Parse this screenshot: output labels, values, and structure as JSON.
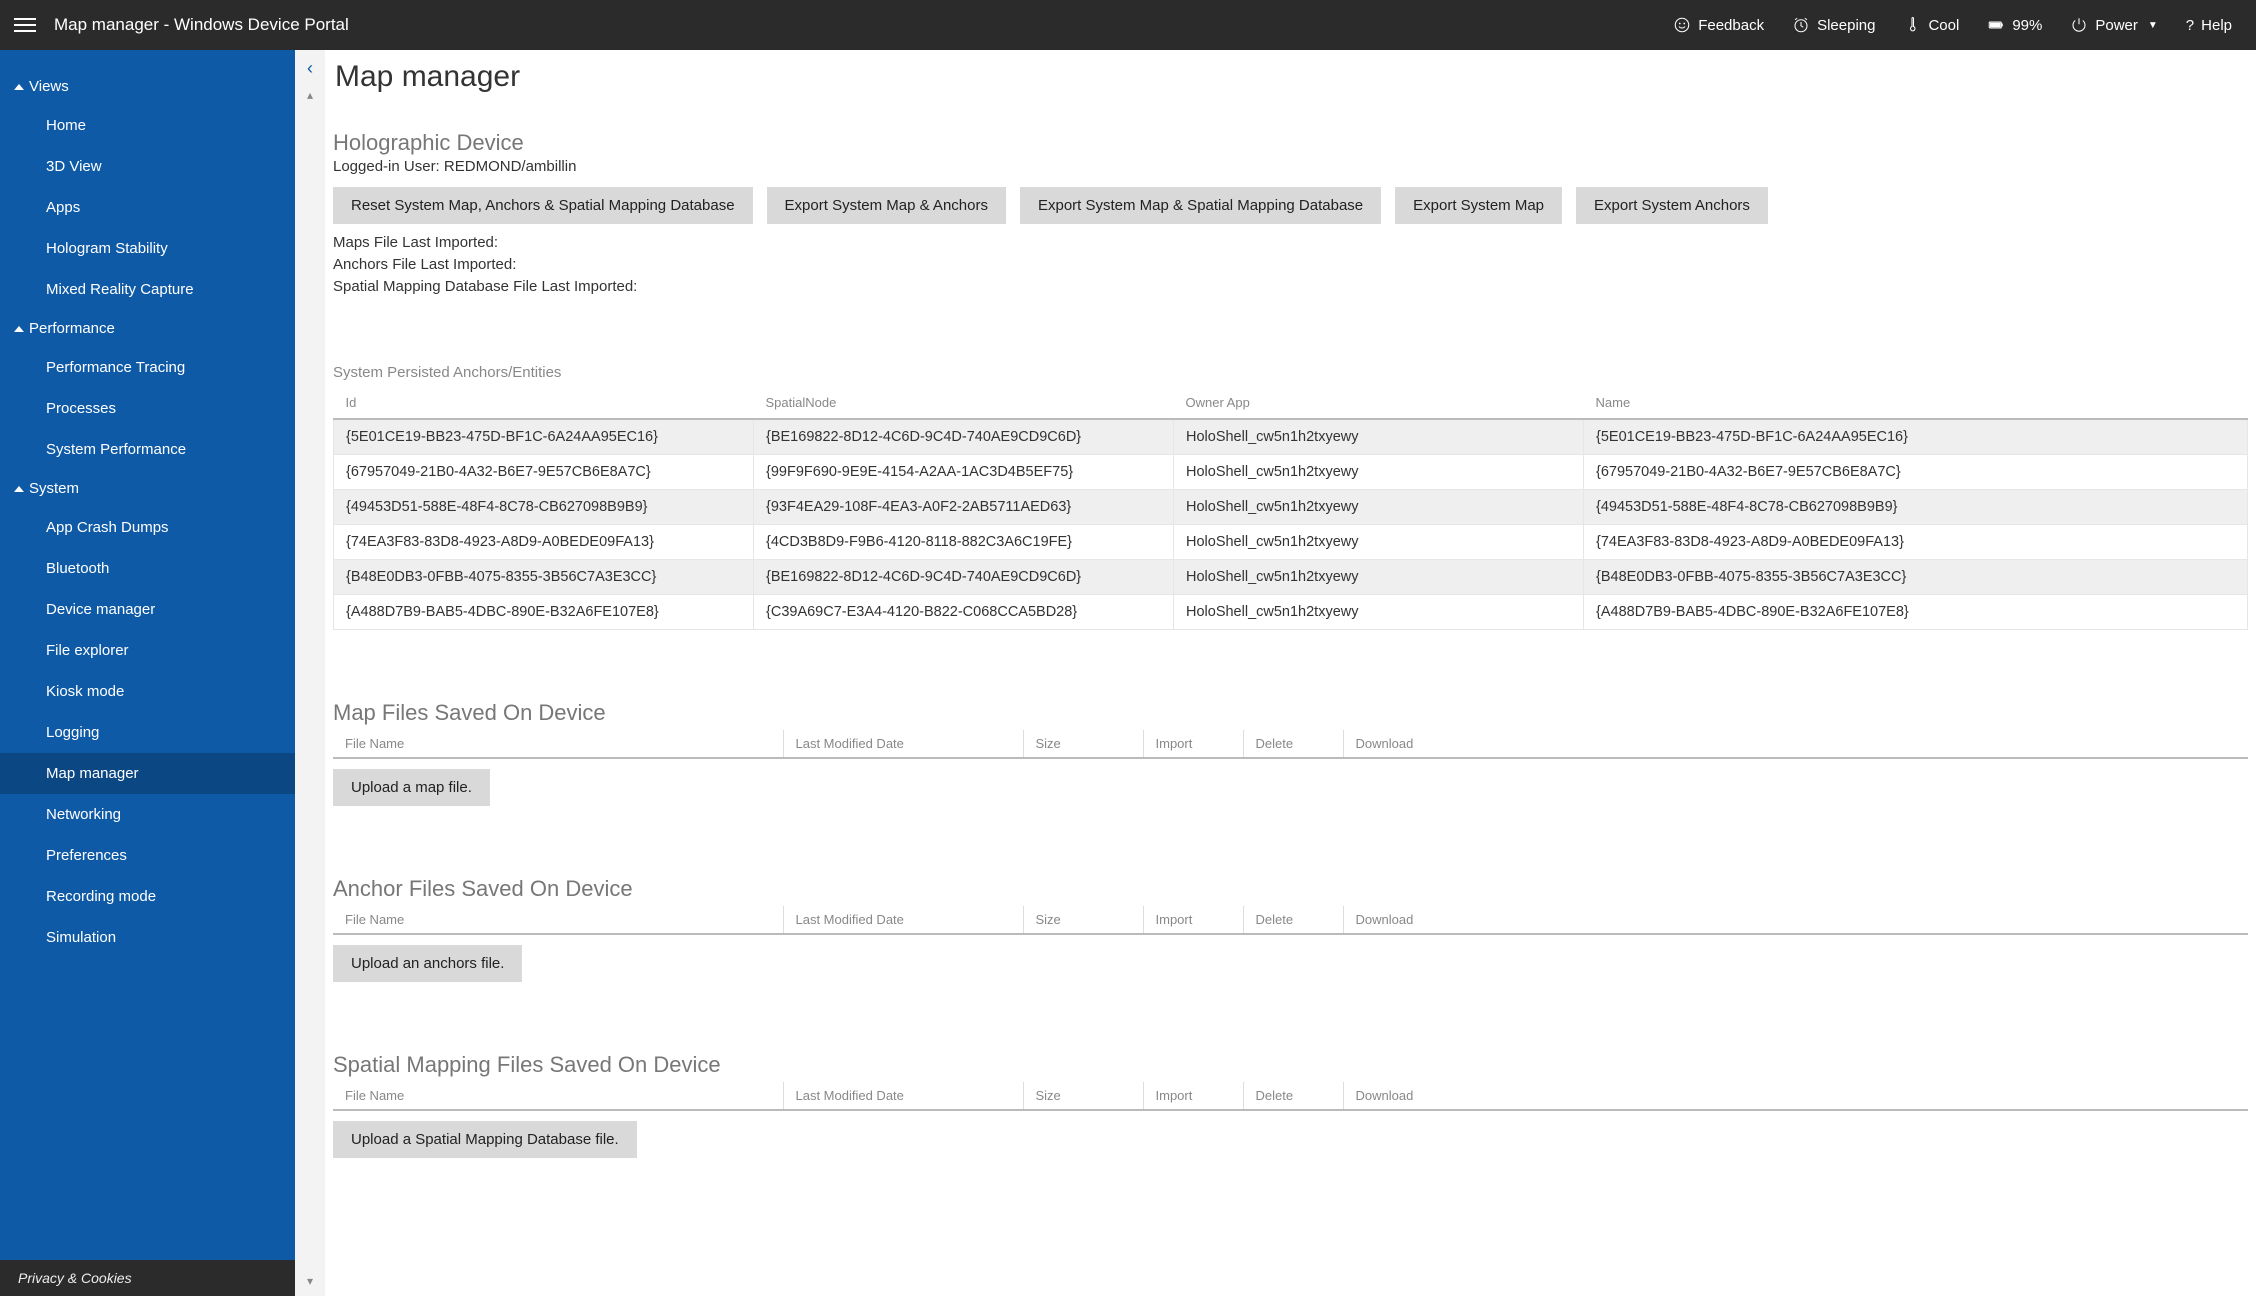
{
  "topbar": {
    "title": "Map manager - Windows Device Portal",
    "feedback": "Feedback",
    "sleeping": "Sleeping",
    "cool": "Cool",
    "battery": "99%",
    "power": "Power",
    "help": "Help"
  },
  "sidebar": {
    "sections": [
      {
        "label": "Views",
        "items": [
          "Home",
          "3D View",
          "Apps",
          "Hologram Stability",
          "Mixed Reality Capture"
        ]
      },
      {
        "label": "Performance",
        "items": [
          "Performance Tracing",
          "Processes",
          "System Performance"
        ]
      },
      {
        "label": "System",
        "items": [
          "App Crash Dumps",
          "Bluetooth",
          "Device manager",
          "File explorer",
          "Kiosk mode",
          "Logging",
          "Map manager",
          "Networking",
          "Preferences",
          "Recording mode",
          "Simulation"
        ]
      }
    ],
    "active": "Map manager",
    "footer": "Privacy & Cookies"
  },
  "page": {
    "title": "Map manager",
    "holo_title": "Holographic Device",
    "logged_in_prefix": "Logged-in User: ",
    "logged_in_user": "REDMOND/ambillin",
    "buttons": {
      "reset": "Reset System Map, Anchors & Spatial Mapping Database",
      "export_map_anchors": "Export System Map & Anchors",
      "export_map_spatial": "Export System Map & Spatial Mapping Database",
      "export_map": "Export System Map",
      "export_anchors": "Export System Anchors"
    },
    "info": {
      "maps_last": "Maps File Last Imported:",
      "anchors_last": "Anchors File Last Imported:",
      "spatial_last": "Spatial Mapping Database File Last Imported:"
    },
    "anchors_title": "System Persisted Anchors/Entities",
    "anchors_headers": {
      "id": "Id",
      "node": "SpatialNode",
      "owner": "Owner App",
      "name": "Name"
    },
    "anchors_rows": [
      {
        "id": "{5E01CE19-BB23-475D-BF1C-6A24AA95EC16}",
        "node": "{BE169822-8D12-4C6D-9C4D-740AE9CD9C6D}",
        "owner": "HoloShell_cw5n1h2txyewy",
        "name": "{5E01CE19-BB23-475D-BF1C-6A24AA95EC16}"
      },
      {
        "id": "{67957049-21B0-4A32-B6E7-9E57CB6E8A7C}",
        "node": "{99F9F690-9E9E-4154-A2AA-1AC3D4B5EF75}",
        "owner": "HoloShell_cw5n1h2txyewy",
        "name": "{67957049-21B0-4A32-B6E7-9E57CB6E8A7C}"
      },
      {
        "id": "{49453D51-588E-48F4-8C78-CB627098B9B9}",
        "node": "{93F4EA29-108F-4EA3-A0F2-2AB5711AED63}",
        "owner": "HoloShell_cw5n1h2txyewy",
        "name": "{49453D51-588E-48F4-8C78-CB627098B9B9}"
      },
      {
        "id": "{74EA3F83-83D8-4923-A8D9-A0BEDE09FA13}",
        "node": "{4CD3B8D9-F9B6-4120-8118-882C3A6C19FE}",
        "owner": "HoloShell_cw5n1h2txyewy",
        "name": "{74EA3F83-83D8-4923-A8D9-A0BEDE09FA13}"
      },
      {
        "id": "{B48E0DB3-0FBB-4075-8355-3B56C7A3E3CC}",
        "node": "{BE169822-8D12-4C6D-9C4D-740AE9CD9C6D}",
        "owner": "HoloShell_cw5n1h2txyewy",
        "name": "{B48E0DB3-0FBB-4075-8355-3B56C7A3E3CC}"
      },
      {
        "id": "{A488D7B9-BAB5-4DBC-890E-B32A6FE107E8}",
        "node": "{C39A69C7-E3A4-4120-B822-C068CCA5BD28}",
        "owner": "HoloShell_cw5n1h2txyewy",
        "name": "{A488D7B9-BAB5-4DBC-890E-B32A6FE107E8}"
      }
    ],
    "file_headers": {
      "fname": "File Name",
      "modified": "Last Modified Date",
      "size": "Size",
      "import": "Import",
      "delete": "Delete",
      "download": "Download"
    },
    "map_files_title": "Map Files Saved On Device",
    "upload_map": "Upload a map file.",
    "anchor_files_title": "Anchor Files Saved On Device",
    "upload_anchors": "Upload an anchors file.",
    "spatial_files_title": "Spatial Mapping Files Saved On Device",
    "upload_spatial": "Upload a Spatial Mapping Database file."
  }
}
